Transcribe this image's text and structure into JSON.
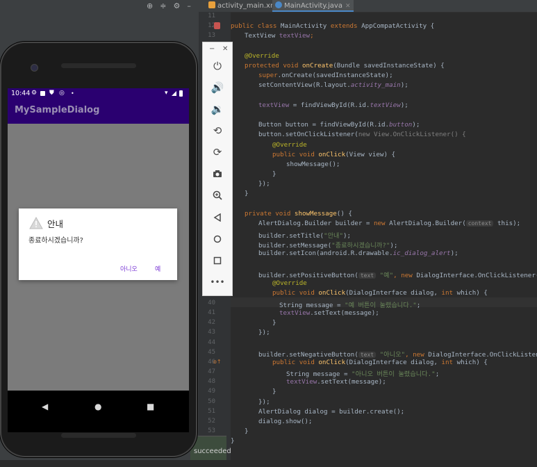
{
  "ide": {
    "tabs": [
      {
        "label": "activity_main.xml"
      },
      {
        "label": "MainActivity.java"
      }
    ],
    "line_numbers": [
      "11",
      "12",
      "13",
      "",
      "",
      "",
      "",
      "",
      "",
      "",
      "",
      "",
      "",
      "",
      "",
      "",
      "",
      "",
      "",
      "",
      "",
      "",
      "",
      "",
      "",
      "",
      "",
      "",
      "",
      "40",
      "41",
      "42",
      "43",
      "44",
      "45",
      "46",
      "47",
      "48",
      "49",
      "50",
      "51",
      "52",
      "53"
    ],
    "build_status": "succeeded"
  },
  "code": {
    "l12": [
      "public class ",
      "MainActivity ",
      "extends ",
      "AppCompatActivity {"
    ],
    "l13": [
      "TextView ",
      "textView",
      ";"
    ],
    "override": "@Override",
    "oncreate_sig": [
      "protected void ",
      "onCreate",
      "(Bundle savedInstanceState) {"
    ],
    "super_call": [
      "super",
      ".onCreate(savedInstanceState);"
    ],
    "set_content": [
      "setContentView(R.layout.",
      "activity_main",
      ");"
    ],
    "find_text": [
      "textView",
      " = findViewById(R.id.",
      "textView",
      ");"
    ],
    "find_button": [
      "Button button = findViewById(R.id.",
      "button",
      ");"
    ],
    "set_listener": [
      "button.setOnClickListener(",
      "new View.OnClickListener() {"
    ],
    "onclick_sig": [
      "public void ",
      "onClick",
      "(View view) {"
    ],
    "show_call": "showMessage();",
    "close_brace": "}",
    "close_paren": "});",
    "show_sig": [
      "private void ",
      "showMessage",
      "() {"
    ],
    "builder_new": [
      "AlertDialog.Builder builder = ",
      "new ",
      "AlertDialog.Builder(",
      "context",
      "this);"
    ],
    "set_title": [
      "builder.setTitle(",
      "\"안내\"",
      ");"
    ],
    "set_message": [
      "builder.setMessage(",
      "\"종료하시겠습니까?\"",
      ");"
    ],
    "set_icon": [
      "builder.setIcon(android.R.drawable.",
      "ic_dialog_alert",
      ");"
    ],
    "set_positive": [
      "builder.setPositiveButton(",
      "text",
      "\"예\"",
      ", ",
      "new ",
      "DialogInterface.OnClickListener() {"
    ],
    "onclick_dlg": [
      "public void ",
      "onClick",
      "(DialogInterface dialog, ",
      "int ",
      "which) {"
    ],
    "msg_yes": [
      "String message = ",
      "\"예 버튼이 눌렸습니다.\"",
      ";"
    ],
    "set_text": [
      "textView",
      ".setText(message);"
    ],
    "set_negative": [
      "builder.setNegativeButton(",
      "text",
      "\"아니오\"",
      ", ",
      "new ",
      "DialogInterface.OnClickListener() {"
    ],
    "msg_no": [
      "String message = ",
      "\"아니오 버튼이 눌렸습니다.\"",
      ";"
    ],
    "create": "AlertDialog dialog = builder.create();",
    "show": "dialog.show();"
  },
  "phone": {
    "status_time": "10:44",
    "app_title": "MySampleDialog",
    "dialog": {
      "title": "안내",
      "message": "종료하시겠습니까?",
      "negative_label": "아니오",
      "positive_label": "예"
    }
  },
  "emulator_toolbar": {
    "buttons": [
      "power-icon",
      "volume-up-icon",
      "volume-down-icon",
      "rotate-left-icon",
      "rotate-right-icon",
      "camera-icon",
      "zoom-icon",
      "back-icon",
      "home-icon",
      "overview-icon",
      "more-icon"
    ]
  },
  "colors": {
    "app_bar": "#2a0070",
    "dialog_button": "#7c3ad6"
  }
}
